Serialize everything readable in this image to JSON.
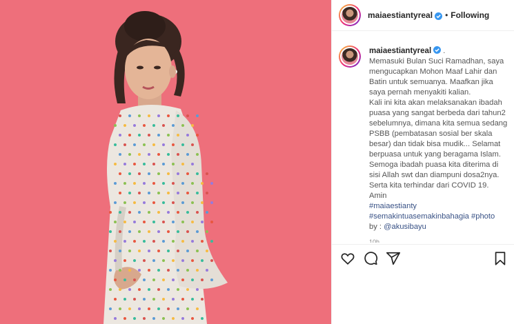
{
  "post": {
    "username": "maiaestiantyreal",
    "separator": "•",
    "follow_label": "Following",
    "caption_user": "maiaestiantyreal",
    "caption_suffix": " .",
    "caption_lines": [
      "Memasuki Bulan Suci Ramadhan, saya mengucapkan Mohon Maaf Lahir dan Batin untuk semuanya. Maafkan jika saya pernah menyakiti kalian.",
      "Kali ini kita akan melaksanakan ibadah puasa yang sangat berbeda dari tahun2 sebelumnya, dimana kita semua sedang PSBB (pembatasan sosial ber skala besar) dan tidak bisa mudik... Selamat berpuasa untuk yang beragama Islam. Semoga ibadah puasa kita diterima di sisi Allah swt dan diampuni dosa2nya. Serta kita terhindar dari COVID 19. Amin"
    ],
    "hashtag_1": "#maiaestianty",
    "hashtag_2": "#semakintuasemakinbahagia #photo",
    "credit_prefix": "by : ",
    "credit_handle": "@akusibayu",
    "time_ago": "10h"
  },
  "icons": {
    "avatar": "avatar-photo",
    "verified": "verified-badge-icon",
    "like": "heart-icon",
    "comment": "comment-icon",
    "share": "share-icon",
    "save": "bookmark-icon"
  },
  "colors": {
    "photo_background": "#ee6f7b",
    "verified_blue": "#3897f0",
    "link_blue": "#385185",
    "text_dark": "#262626"
  }
}
